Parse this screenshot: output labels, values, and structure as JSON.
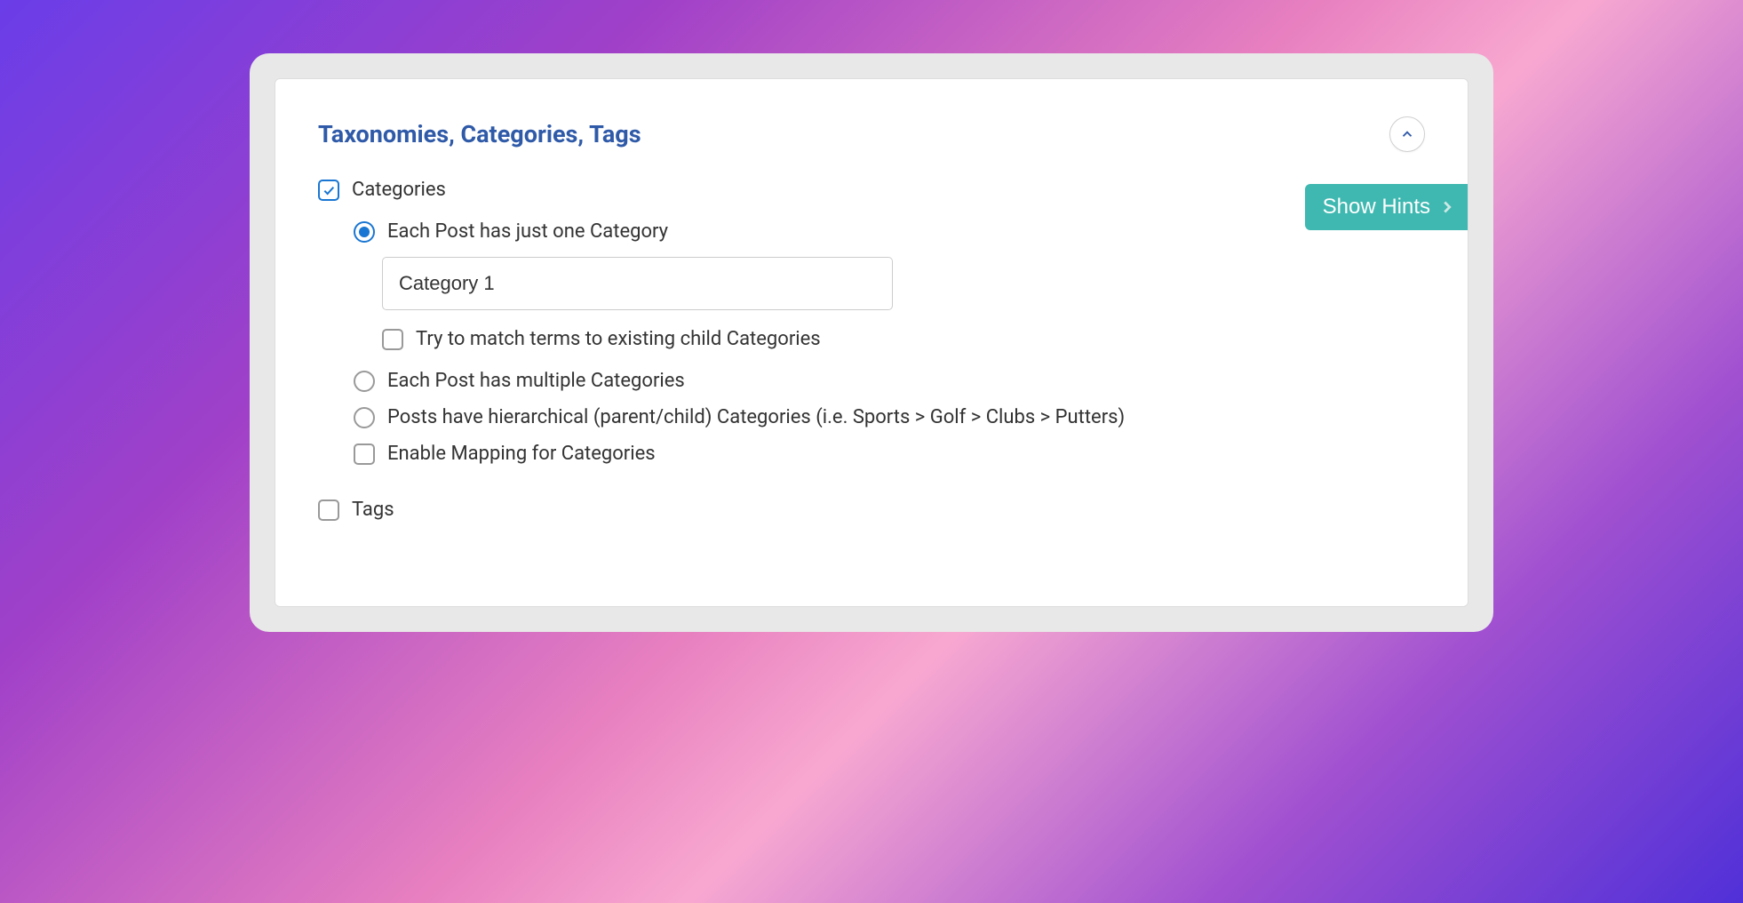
{
  "panel": {
    "title": "Taxonomies, Categories, Tags"
  },
  "hints": {
    "show_label": "Show Hints"
  },
  "categories": {
    "label": "Categories",
    "checked": true,
    "options": {
      "single": {
        "label": "Each Post has just one Category",
        "selected": true,
        "input_value": "Category 1",
        "match_terms_label": "Try to match terms to existing child Categories",
        "match_terms_checked": false
      },
      "multiple": {
        "label": "Each Post has multiple Categories",
        "selected": false
      },
      "hierarchical": {
        "label": "Posts have hierarchical (parent/child) Categories (i.e. Sports > Golf > Clubs > Putters)",
        "selected": false
      }
    },
    "enable_mapping": {
      "label": "Enable Mapping for Categories",
      "checked": false
    }
  },
  "tags": {
    "label": "Tags",
    "checked": false
  }
}
